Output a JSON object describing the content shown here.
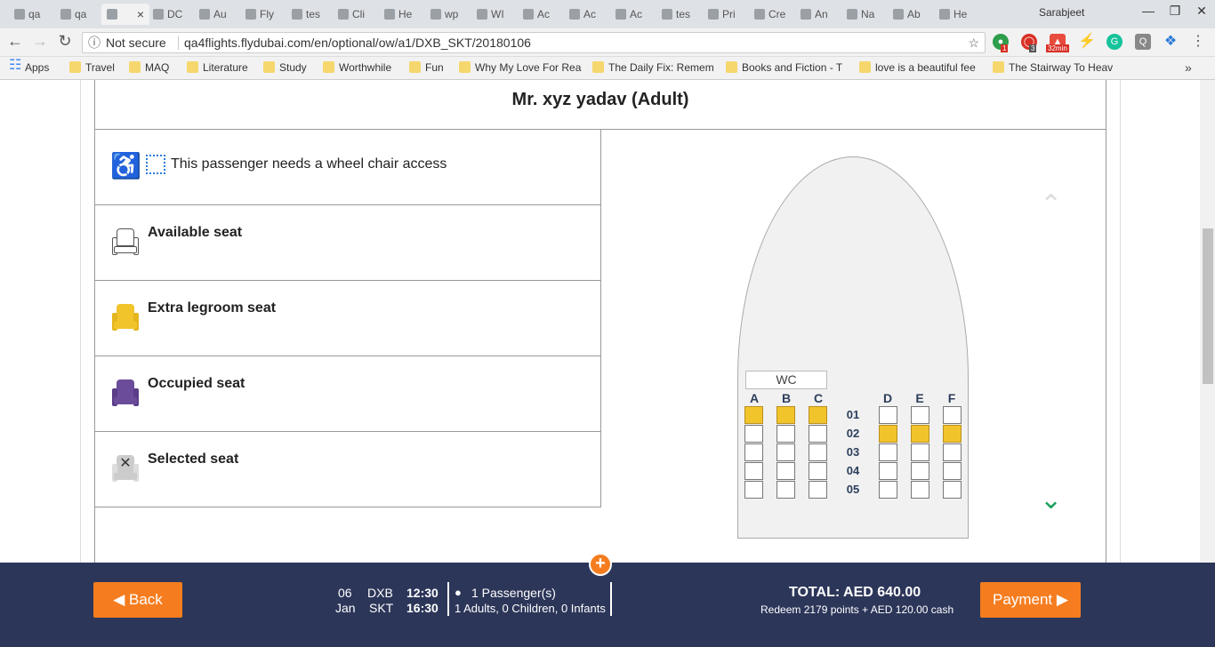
{
  "browser": {
    "tabs": [
      "qa",
      "qa",
      "",
      "DC",
      "Au",
      "Fly",
      "tes",
      "Cli",
      "He",
      "wp",
      "WI",
      "Ac",
      "Ac",
      "Ac",
      "tes",
      "Pri",
      "Cre",
      "An",
      "Na",
      "Ab",
      "He"
    ],
    "active_tab_index": 2,
    "user": "Sarabjeet",
    "security": "Not secure",
    "url": "qa4flights.flydubai.com/en/optional/ow/a1/DXB_SKT/20180106",
    "extension_badges": [
      "1",
      "3",
      "32min"
    ],
    "bookmarks": [
      "Apps",
      "Travel",
      "MAQ",
      "Literature",
      "Study",
      "Worthwhile",
      "Fun",
      "Why My Love For Rea",
      "The Daily Fix: Remem",
      "Books and Fiction - T",
      "love is a beautiful fee",
      "The Stairway To Heav"
    ],
    "more": "»"
  },
  "passenger": {
    "name": "Mr. xyz yadav (Adult)"
  },
  "legend": {
    "wheelchair": "This passenger needs a wheel chair access",
    "available": "Available seat",
    "extra": "Extra legroom seat",
    "occupied": "Occupied seat",
    "selected": "Selected seat"
  },
  "seatmap": {
    "wc_label": "WC",
    "columns": [
      "A",
      "B",
      "C",
      "D",
      "E",
      "F"
    ],
    "rows": [
      "01",
      "02",
      "03",
      "04",
      "05"
    ],
    "extra_legroom": {
      "01": [
        "A",
        "B",
        "C"
      ],
      "02": [
        "D",
        "E",
        "F"
      ]
    }
  },
  "footer": {
    "back": "Back",
    "day": "06",
    "month": "Jan",
    "from": "DXB",
    "to": "SKT",
    "dep_time": "12:30",
    "arr_time": "16:30",
    "passengers": "1 Passenger(s)",
    "breakdown": "1 Adults, 0 Children, 0 Infants",
    "total": "TOTAL: AED 640.00",
    "redeem": "Redeem 2179 points + AED 120.00 cash",
    "payment": "Payment"
  },
  "colors": {
    "accent": "#f57d1f",
    "footer_bg": "#2c3659",
    "extra_seat": "#f2c42c",
    "occupied_seat": "#6b4c9a",
    "next_arrow": "#1aa05a"
  }
}
